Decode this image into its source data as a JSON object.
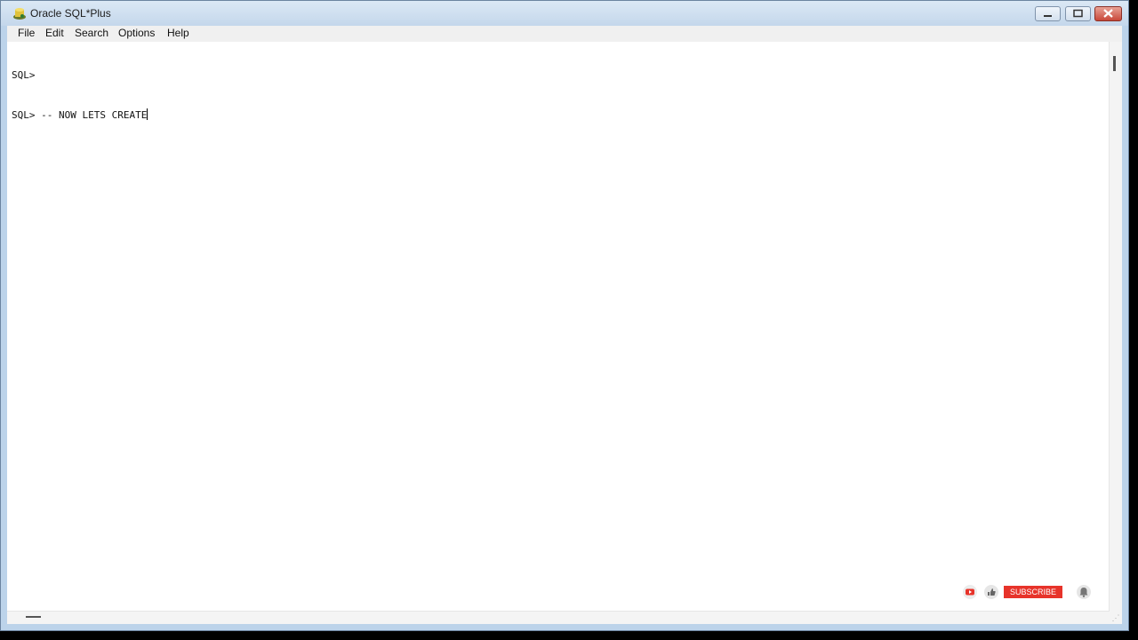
{
  "window": {
    "title": "Oracle SQL*Plus"
  },
  "menu": {
    "items": [
      "File",
      "Edit",
      "Search",
      "Options",
      "Help"
    ]
  },
  "console": {
    "lines": [
      "SQL>",
      "SQL> -- NOW LETS CREATE"
    ]
  },
  "overlay": {
    "subscribe_label": "SUBSCRIBE"
  },
  "colors": {
    "subscribe_red": "#e7332a",
    "close_button_red": "#c9483a"
  }
}
